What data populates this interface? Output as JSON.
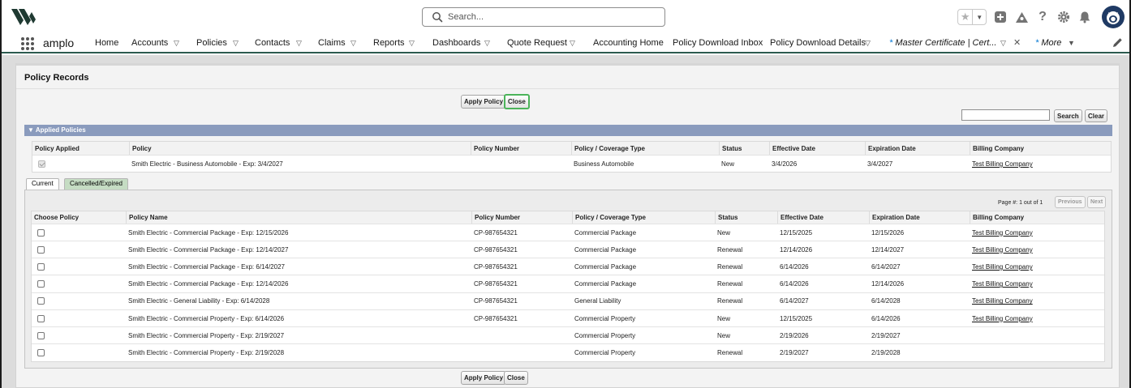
{
  "header": {
    "search_placeholder": "Search...",
    "colors": {
      "brand_dark": "#1f3a32",
      "nav_border": "#2c5b4f",
      "section_bar": "#8a9bbd",
      "active_tab": "#c5dcc3",
      "focus_green": "#4cb45a"
    }
  },
  "nav": {
    "app_name": "amplo",
    "items": [
      {
        "label": "Home",
        "dropdown": false
      },
      {
        "label": "Accounts",
        "dropdown": true
      },
      {
        "label": "Policies",
        "dropdown": true
      },
      {
        "label": "Contacts",
        "dropdown": true
      },
      {
        "label": "Claims",
        "dropdown": true
      },
      {
        "label": "Reports",
        "dropdown": true
      },
      {
        "label": "Dashboards",
        "dropdown": true
      },
      {
        "label": "Quote Request",
        "dropdown": true
      },
      {
        "label": "Accounting Home",
        "dropdown": false
      },
      {
        "label": "Policy Download Inbox",
        "dropdown": false
      },
      {
        "label": "Policy Download Details",
        "dropdown": true
      }
    ],
    "active_tab": {
      "marker": "*",
      "label": "Master Certificate | Cert..."
    },
    "more": {
      "marker": "*",
      "label": "More"
    }
  },
  "panel": {
    "title": "Policy Records",
    "apply_label": "Apply Policy",
    "close_label": "Close",
    "search_label": "Search",
    "clear_label": "Clear"
  },
  "applied": {
    "title": "Applied Policies",
    "headers": [
      "Policy Applied",
      "Policy",
      "Policy Number",
      "Policy / Coverage Type",
      "Status",
      "Effective Date",
      "Expiration Date",
      "Billing Company"
    ],
    "rows": [
      {
        "policy": "Smith Electric - Business Automobile - Exp: 3/4/2027",
        "number": "",
        "type": "Business Automobile",
        "status": "New",
        "effective": "3/4/2026",
        "expiration": "3/4/2027",
        "billing": "Test Billing Company"
      }
    ]
  },
  "tabs": {
    "current": "Current",
    "cancelled": "Cancelled/Expired"
  },
  "pager": {
    "label": "Page #: 1 out of 1",
    "previous": "Previous",
    "next": "Next"
  },
  "policies": {
    "headers": [
      "Choose Policy",
      "Policy Name",
      "Policy Number",
      "Policy / Coverage Type",
      "Status",
      "Effective Date",
      "Expiration Date",
      "Billing Company"
    ],
    "rows": [
      {
        "name": "Smith Electric - Commercial Package - Exp: 12/15/2026",
        "number": "CP-987654321",
        "type": "Commercial Package",
        "status": "New",
        "effective": "12/15/2025",
        "expiration": "12/15/2026",
        "billing": "Test Billing Company"
      },
      {
        "name": "Smith Electric - Commercial Package - Exp: 12/14/2027",
        "number": "CP-987654321",
        "type": "Commercial Package",
        "status": "Renewal",
        "effective": "12/14/2026",
        "expiration": "12/14/2027",
        "billing": "Test Billing Company"
      },
      {
        "name": "Smith Electric - Commercial Package - Exp: 6/14/2027",
        "number": "CP-987654321",
        "type": "Commercial Package",
        "status": "Renewal",
        "effective": "6/14/2026",
        "expiration": "6/14/2027",
        "billing": "Test Billing Company"
      },
      {
        "name": "Smith Electric - Commercial Package - Exp: 12/14/2026",
        "number": "CP-987654321",
        "type": "Commercial Package",
        "status": "Renewal",
        "effective": "6/14/2026",
        "expiration": "12/14/2026",
        "billing": "Test Billing Company"
      },
      {
        "name": "Smith Electric - General Liability - Exp: 6/14/2028",
        "number": "CP-987654321",
        "type": "General Liability",
        "status": "Renewal",
        "effective": "6/14/2027",
        "expiration": "6/14/2028",
        "billing": "Test Billing Company"
      },
      {
        "name": "Smith Electric - Commercial Property - Exp: 6/14/2026",
        "number": "CP-987654321",
        "type": "Commercial Property",
        "status": "New",
        "effective": "12/15/2025",
        "expiration": "6/14/2026",
        "billing": "Test Billing Company"
      },
      {
        "name": "Smith Electric - Commercial Property - Exp: 2/19/2027",
        "number": "",
        "type": "Commercial Property",
        "status": "New",
        "effective": "2/19/2026",
        "expiration": "2/19/2027",
        "billing": ""
      },
      {
        "name": "Smith Electric - Commercial Property - Exp: 2/19/2028",
        "number": "",
        "type": "Commercial Property",
        "status": "Renewal",
        "effective": "2/19/2027",
        "expiration": "2/19/2028",
        "billing": ""
      }
    ]
  }
}
